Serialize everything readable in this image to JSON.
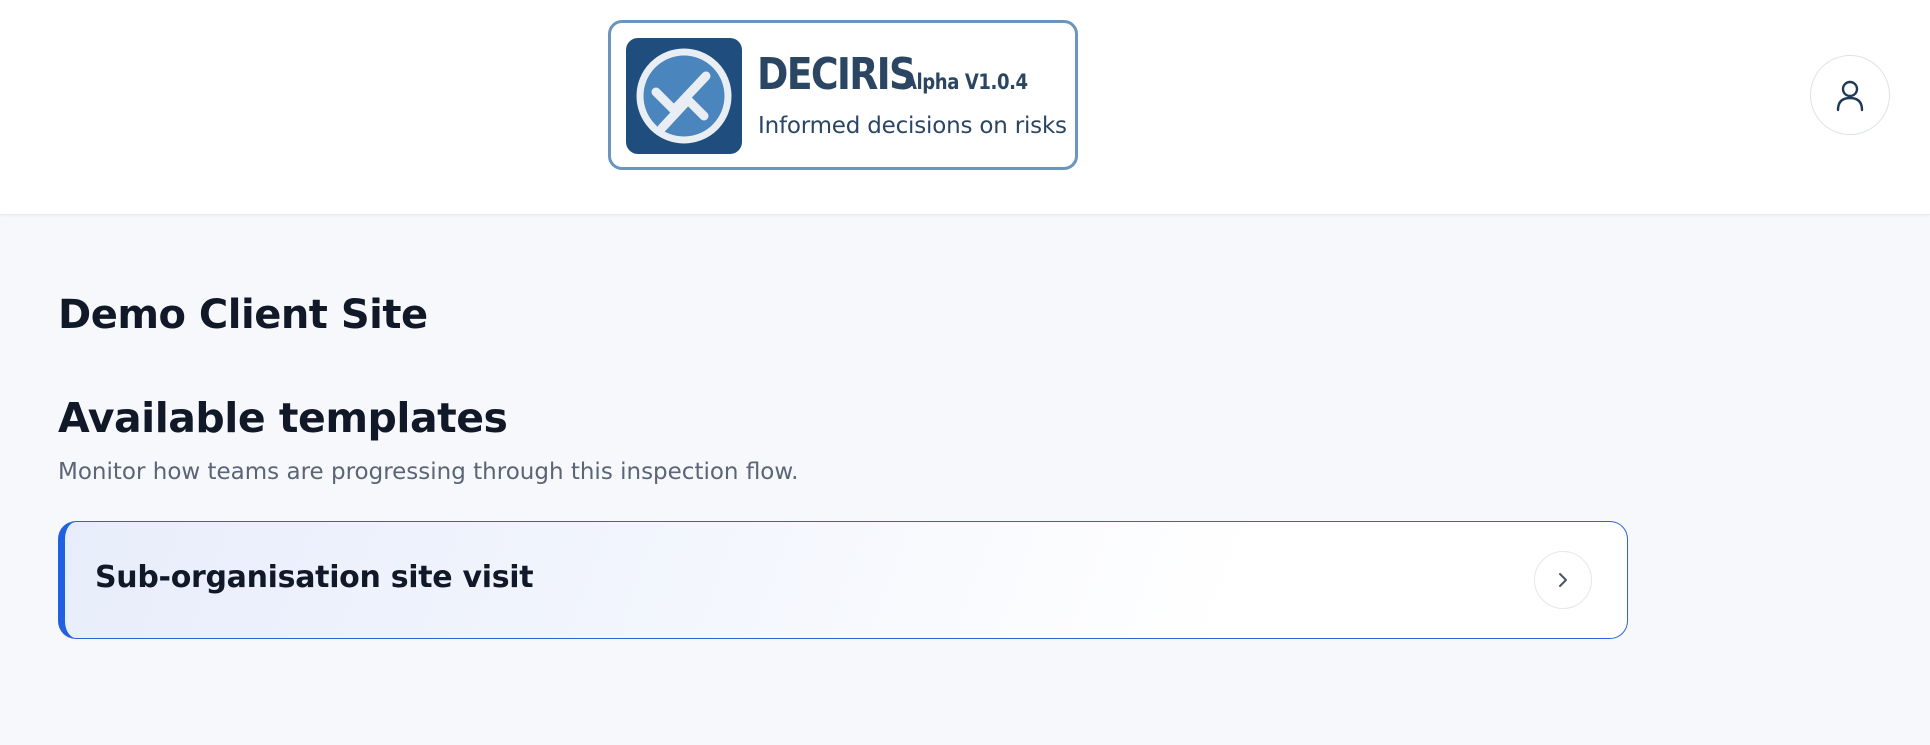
{
  "header": {
    "brand": {
      "name": "DECIRIS",
      "version": "Alpha V1.0.4",
      "tagline": "Informed decisions on risks",
      "logo_icon": "check-trend-logo-icon"
    },
    "user_menu": {
      "icon": "user-icon"
    }
  },
  "main": {
    "page_title": "Demo Client Site",
    "section": {
      "title": "Available templates",
      "subtitle": "Monitor how teams are progressing through this inspection flow."
    },
    "templates": [
      {
        "name": "Sub-organisation site visit",
        "icon": "chevron-right-icon"
      }
    ]
  },
  "colors": {
    "brand_dark": "#1f4e7e",
    "brand_text": "#2a4663",
    "accent": "#2160e0",
    "page_bg": "#f6f8fc"
  }
}
